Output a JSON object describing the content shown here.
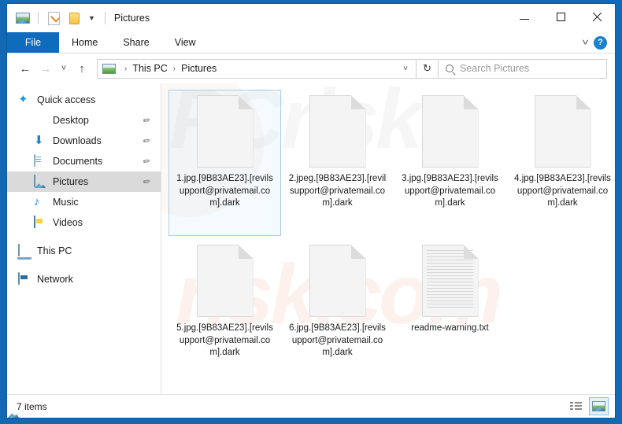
{
  "window": {
    "title": "Pictures",
    "quick_access_toolbar": [
      {
        "name": "pictures-library-icon",
        "label": "Pictures"
      },
      {
        "name": "properties-icon",
        "label": "Properties"
      },
      {
        "name": "new-folder-icon",
        "label": "New folder"
      },
      {
        "name": "customize-chevron-icon",
        "label": "Customize Quick Access Toolbar"
      }
    ],
    "controls": {
      "minimize": "Minimize",
      "maximize": "Maximize",
      "close": "Close"
    }
  },
  "ribbon": {
    "tabs": [
      {
        "label": "File",
        "active": true
      },
      {
        "label": "Home",
        "active": false
      },
      {
        "label": "Share",
        "active": false
      },
      {
        "label": "View",
        "active": false
      }
    ],
    "collapse_label": "Minimize the Ribbon",
    "help_label": "?"
  },
  "address_bar": {
    "back": "Back",
    "forward": "Forward",
    "recent": "Recent locations",
    "up": "Up",
    "location_icon": "pictures-library-icon",
    "crumbs": [
      "This PC",
      "Pictures"
    ],
    "separator": "›",
    "dropdown": "Previous locations",
    "refresh": "Refresh"
  },
  "search": {
    "placeholder": "Search Pictures",
    "value": ""
  },
  "sidebar": {
    "items": [
      {
        "label": "Quick access",
        "icon": "star-icon",
        "level": "root",
        "pinned": false,
        "selected": false
      },
      {
        "label": "Desktop",
        "icon": "desktop-icon",
        "level": "child",
        "pinned": true,
        "selected": false
      },
      {
        "label": "Downloads",
        "icon": "download-icon",
        "level": "child",
        "pinned": true,
        "selected": false
      },
      {
        "label": "Documents",
        "icon": "documents-icon",
        "level": "child",
        "pinned": true,
        "selected": false
      },
      {
        "label": "Pictures",
        "icon": "pictures-icon",
        "level": "child",
        "pinned": true,
        "selected": true
      },
      {
        "label": "Music",
        "icon": "music-icon",
        "level": "child",
        "pinned": false,
        "selected": false
      },
      {
        "label": "Videos",
        "icon": "videos-icon",
        "level": "child",
        "pinned": false,
        "selected": false
      },
      {
        "label": "This PC",
        "icon": "this-pc-icon",
        "level": "root",
        "pinned": false,
        "selected": false
      },
      {
        "label": "Network",
        "icon": "network-icon",
        "level": "root",
        "pinned": false,
        "selected": false
      }
    ],
    "pin_glyph": "✐"
  },
  "files": [
    {
      "name": "1.jpg.[9B83AE23].[revilsupport@privatemail.com].dark",
      "icon": "blank-file-icon",
      "selected": true
    },
    {
      "name": "2.jpeg.[9B83AE23].[revilsupport@privatemail.com].dark",
      "icon": "blank-file-icon",
      "selected": false
    },
    {
      "name": "3.jpg.[9B83AE23].[revilsupport@privatemail.com].dark",
      "icon": "blank-file-icon",
      "selected": false
    },
    {
      "name": "4.jpg.[9B83AE23].[revilsupport@privatemail.com].dark",
      "icon": "blank-file-icon",
      "selected": false
    },
    {
      "name": "5.jpg.[9B83AE23].[revilsupport@privatemail.com].dark",
      "icon": "blank-file-icon",
      "selected": false
    },
    {
      "name": "6.jpg.[9B83AE23].[revilsupport@privatemail.com].dark",
      "icon": "blank-file-icon",
      "selected": false
    },
    {
      "name": "readme-warning.txt",
      "icon": "text-file-icon",
      "selected": false
    }
  ],
  "status_bar": {
    "item_count": "7 items",
    "views": [
      {
        "name": "details-view-button",
        "label": "Details view",
        "active": false
      },
      {
        "name": "large-icons-view-button",
        "label": "Large icons view",
        "active": true
      }
    ]
  },
  "watermark": {
    "gray_text": "PCrisk",
    "red_text": "risk.com"
  },
  "colors": {
    "accent": "#0f6cbd",
    "desktop": "#1268b3",
    "selection_border": "#a9cfe8",
    "sidebar_selected": "#dadada"
  }
}
